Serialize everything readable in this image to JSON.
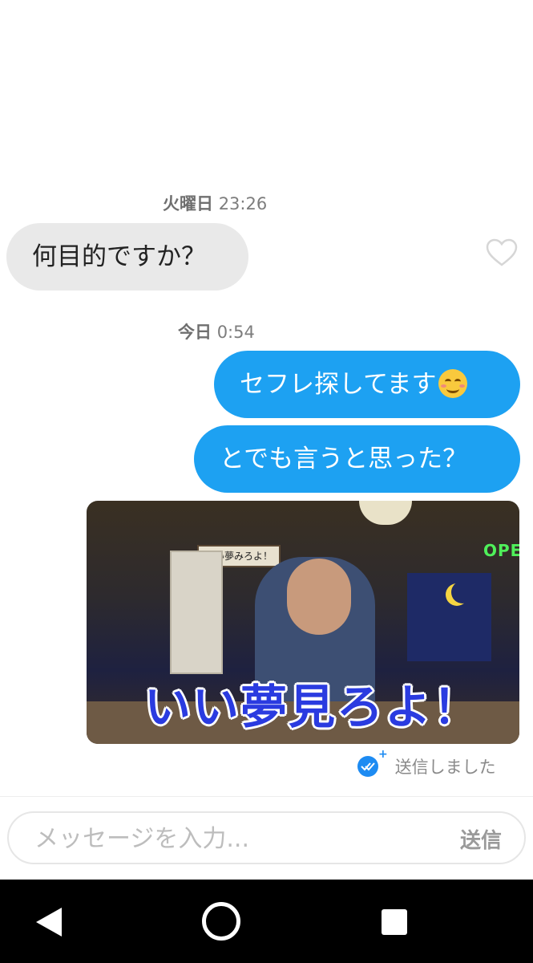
{
  "thread": {
    "incoming": {
      "day": "火曜日",
      "time": "23:26",
      "text": "何目的ですか？"
    },
    "outgoing": {
      "day": "今日",
      "time": "0:54",
      "messages": [
        {
          "text": "セフレ探してます",
          "emoji": "smiling-face-with-smiling-eyes"
        },
        {
          "text": "とでも言うと思った？"
        }
      ],
      "gif": {
        "caption": "いい夢見ろよ！",
        "sign_text": "いい夢みろよ！",
        "neon_text": "OPEN"
      },
      "status": "送信しました"
    }
  },
  "composer": {
    "placeholder": "メッセージを入力...",
    "value": "",
    "send_label": "送信"
  },
  "colors": {
    "outgoing_bubble": "#1da1f2",
    "incoming_bubble": "#e9e9e9",
    "sent_check": "#1d8bf2"
  }
}
